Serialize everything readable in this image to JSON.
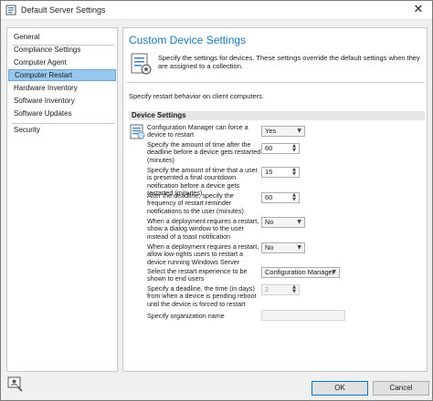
{
  "window": {
    "title": "Default Server Settings",
    "close": "✕"
  },
  "nav": {
    "items": [
      {
        "label": "General"
      },
      {
        "label": "Compliance Settings"
      },
      {
        "label": "Computer Agent"
      },
      {
        "label": "Computer Restart",
        "selected": true
      },
      {
        "label": "Hardware Inventory"
      },
      {
        "label": "Software Inventory"
      },
      {
        "label": "Software Updates"
      },
      {
        "label": "Security"
      }
    ]
  },
  "panel": {
    "title": "Custom Device Settings",
    "description": "Specify the settings for devices. These settings override the default settings when they are assigned to a collection.",
    "subtext": "Specify restart behavior on client computers.",
    "group_header": "Device Settings",
    "settings": [
      {
        "label": "Configuration Manager can force a device to restart",
        "value": "Yes",
        "control": "select"
      },
      {
        "label": "Specify the amount of time after the deadline before a device gets restarted (minutes)",
        "value": "60",
        "control": "spin"
      },
      {
        "label": "Specify the amount of time that a user is presented a final countdown notification before a device gets restarted (minutes)",
        "value": "15",
        "control": "spin"
      },
      {
        "label": "After the deadline, specify the frequency of restart reminder notifications to the user (minutes)",
        "value": "60",
        "control": "spin"
      },
      {
        "label": "When a deployment requires a restart, show a dialog window to the user instead of a toast notification",
        "value": "No",
        "control": "select"
      },
      {
        "label": "When a deployment requires a restart, allow low-rights users to restart a device running Windows Server",
        "value": "No",
        "control": "select"
      },
      {
        "label": "Select the restart experience to be shown to end users",
        "value": "Configuration Manager",
        "control": "select"
      },
      {
        "label": "Specify a deadline, the time (in days) from when a device is pending reboot until the device is forced to restart",
        "value": "2",
        "control": "spin-disabled"
      },
      {
        "label": "Specify organization name",
        "value": "",
        "control": "text"
      }
    ]
  },
  "footer": {
    "ok_label": "OK",
    "cancel_label": "Cancel"
  },
  "colors": {
    "accent": "#1e77b8",
    "selection": "#99c8ee"
  }
}
